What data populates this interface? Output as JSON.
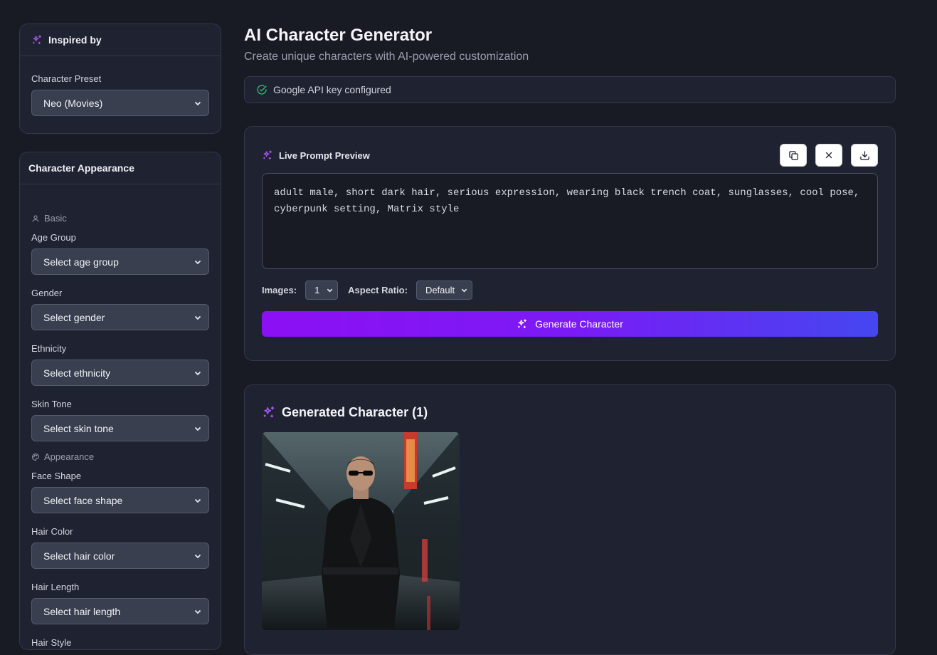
{
  "sidebar": {
    "preset_card": {
      "title": "Inspired by",
      "preset_label": "Character Preset",
      "preset_value": "Neo (Movies)"
    },
    "appearance_card": {
      "title": "Character Appearance",
      "sections": {
        "basic": "Basic",
        "appearance": "Appearance"
      },
      "fields": {
        "age_group": {
          "label": "Age Group",
          "value": "Select age group"
        },
        "gender": {
          "label": "Gender",
          "value": "Select gender"
        },
        "ethnicity": {
          "label": "Ethnicity",
          "value": "Select ethnicity"
        },
        "skin_tone": {
          "label": "Skin Tone",
          "value": "Select skin tone"
        },
        "face_shape": {
          "label": "Face Shape",
          "value": "Select face shape"
        },
        "hair_color": {
          "label": "Hair Color",
          "value": "Select hair color"
        },
        "hair_length": {
          "label": "Hair Length",
          "value": "Select hair length"
        },
        "hair_style": {
          "label": "Hair Style"
        }
      }
    }
  },
  "main": {
    "title": "AI Character Generator",
    "subtitle": "Create unique characters with AI-powered customization",
    "api_status": "Google API key configured",
    "preview": {
      "title": "Live Prompt Preview",
      "prompt": "adult male, short dark hair, serious expression, wearing black trench coat, sunglasses, cool pose, cyberpunk setting, Matrix style",
      "images_label": "Images:",
      "images_value": "1",
      "aspect_label": "Aspect Ratio:",
      "aspect_value": "Default",
      "generate_label": "Generate Character"
    },
    "results": {
      "title": "Generated Character (1)"
    }
  },
  "colors": {
    "background": "#181a24",
    "card": "#1f2230",
    "accent_purple": "#8c10f4",
    "accent_blue": "#4447f0",
    "success_green": "#2fbf71"
  },
  "icons": [
    "sparkles-icon",
    "user-icon",
    "palette-icon",
    "check-circle-icon",
    "copy-icon",
    "close-icon",
    "download-icon",
    "chevron-down-icon"
  ]
}
